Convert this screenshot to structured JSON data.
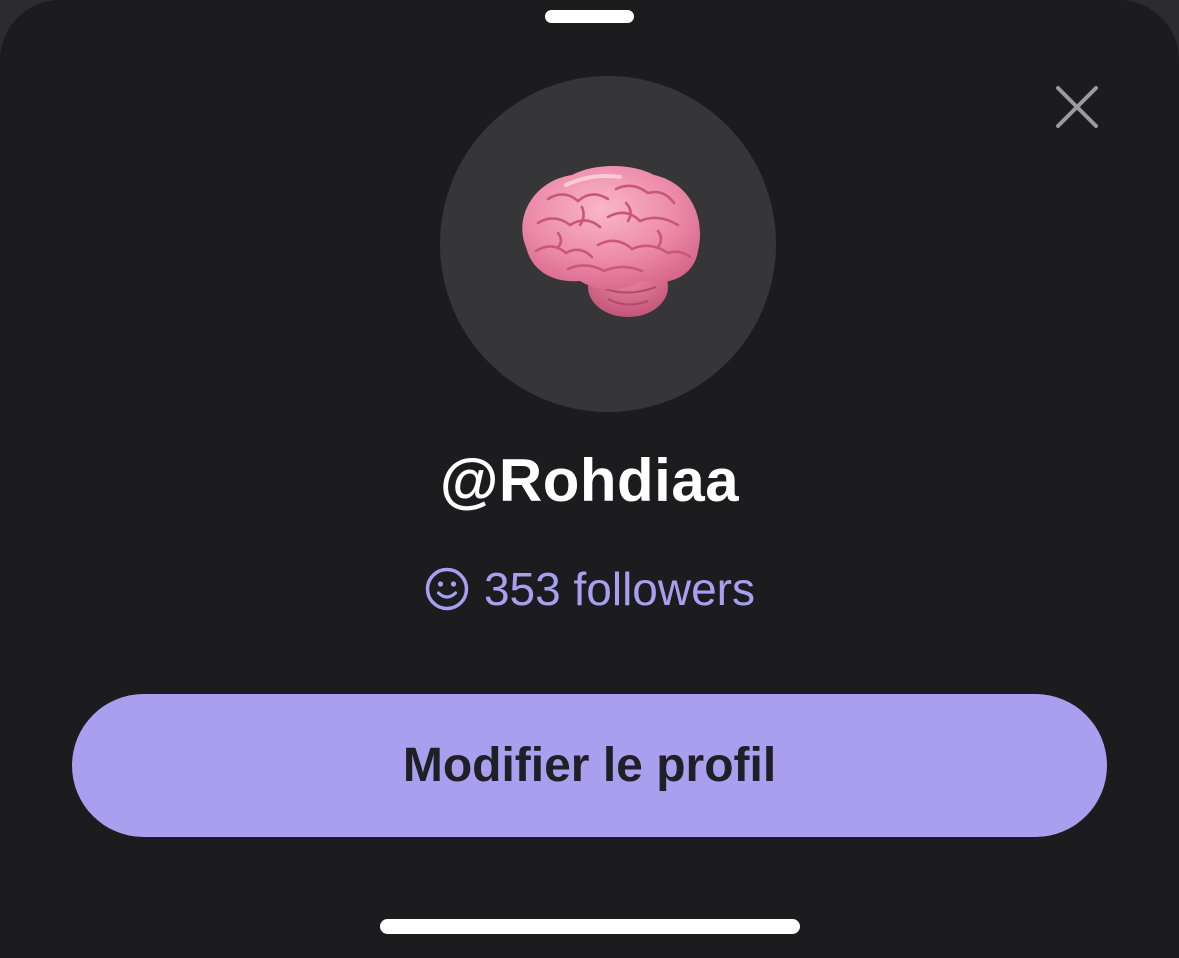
{
  "profile": {
    "username": "@Rohdiaa",
    "followers_text": "353 followers",
    "avatar_icon": "brain-emoji-icon"
  },
  "actions": {
    "edit_profile_label": "Modifier le profil",
    "close_icon": "close-icon"
  },
  "colors": {
    "sheet_background": "#1c1c1e",
    "avatar_background": "#363638",
    "accent": "#aa9eef",
    "followers_text": "#a99ef0",
    "button_text": "#1f1f25"
  }
}
